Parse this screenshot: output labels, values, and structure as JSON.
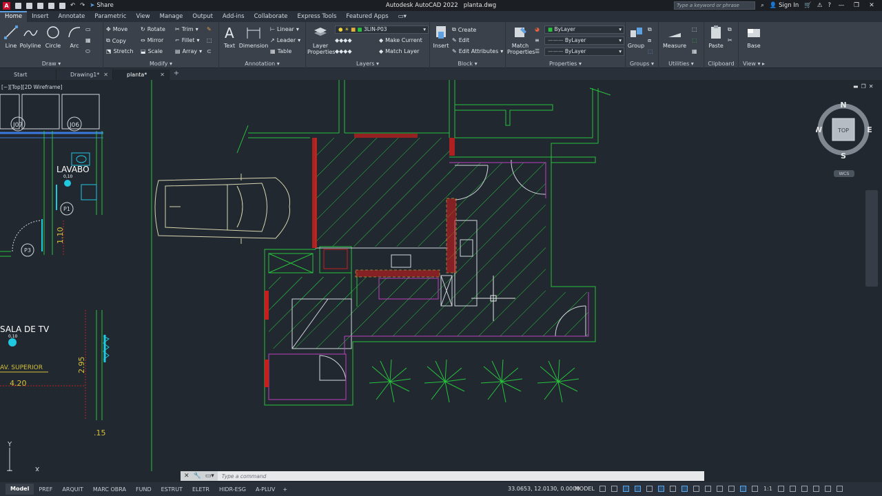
{
  "app": {
    "title": "Autodesk AutoCAD 2022",
    "file": "planta.dwg",
    "share_label": "Share",
    "search_placeholder": "Type a keyword or phrase",
    "sign_in": "Sign In"
  },
  "ribbon_tabs": [
    "Home",
    "Insert",
    "Annotate",
    "Parametric",
    "View",
    "Manage",
    "Output",
    "Add-ins",
    "Collaborate",
    "Express Tools",
    "Featured Apps"
  ],
  "ribbon": {
    "draw": {
      "label": "Draw",
      "line": "Line",
      "polyline": "Polyline",
      "circle": "Circle",
      "arc": "Arc"
    },
    "modify": {
      "label": "Modify",
      "move": "Move",
      "rotate": "Rotate",
      "trim": "Trim",
      "copy": "Copy",
      "mirror": "Mirror",
      "fillet": "Fillet",
      "stretch": "Stretch",
      "scale": "Scale",
      "array": "Array"
    },
    "annotation": {
      "label": "Annotation",
      "text": "Text",
      "dimension": "Dimension",
      "linear": "Linear",
      "leader": "Leader",
      "table": "Table"
    },
    "layers": {
      "label": "Layers",
      "layer_properties": "Layer Properties",
      "current_layer": "3LIN-P03",
      "make_current": "Make Current",
      "match_layer": "Match Layer"
    },
    "block": {
      "label": "Block",
      "insert": "Insert",
      "create": "Create",
      "edit": "Edit",
      "edit_attributes": "Edit Attributes"
    },
    "properties": {
      "label": "Properties",
      "match_properties": "Match Properties",
      "color": "ByLayer",
      "linetype": "ByLayer",
      "lineweight": "ByLayer"
    },
    "groups": {
      "label": "Groups",
      "group": "Group"
    },
    "utilities": {
      "label": "Utilities",
      "measure": "Measure"
    },
    "clipboard": {
      "label": "Clipboard",
      "paste": "Paste"
    },
    "view": {
      "label": "View",
      "base": "Base"
    }
  },
  "doc_tabs": [
    {
      "label": "Start"
    },
    {
      "label": "Drawing1*"
    },
    {
      "label": "planta*"
    }
  ],
  "viewport_label": "[−][Top][2D Wireframe]",
  "viewcube": {
    "n": "N",
    "s": "S",
    "e": "E",
    "w": "W",
    "top": "TOP",
    "wcs": "WCS"
  },
  "drawing_text": {
    "j07": "J07",
    "j06": "J06",
    "lavabo": "LAVABO",
    "level1": "0,10",
    "p1": "P1",
    "dim110": "1.10",
    "p3": "P3",
    "sala": "SALA DE TV",
    "level2": "0,10",
    "superior": "AV. SUPERIOR",
    "dim295": "2.95",
    "dim420": "4.20",
    "dim15": ".15",
    "ucs_y": "Y",
    "ucs_x": "X"
  },
  "command_placeholder": "Type a command",
  "layout_tabs": [
    "Model",
    "PREF",
    "ARQUIT",
    "MARC OBRA",
    "FUND",
    "ESTRUT",
    "ELETR",
    "HIDR-ESG",
    "A-PLUV"
  ],
  "status": {
    "coords": "33.0653, 12.0130, 0.0000",
    "mode": "MODEL",
    "scale": "1:1"
  },
  "colors": {
    "background": "#212830",
    "ribbon": "#3a414b",
    "wall_green": "#27c43d",
    "magenta": "#c03fc0",
    "red": "#c81e1e",
    "yellow": "#d6c23a",
    "cyan": "#20c8e0"
  }
}
